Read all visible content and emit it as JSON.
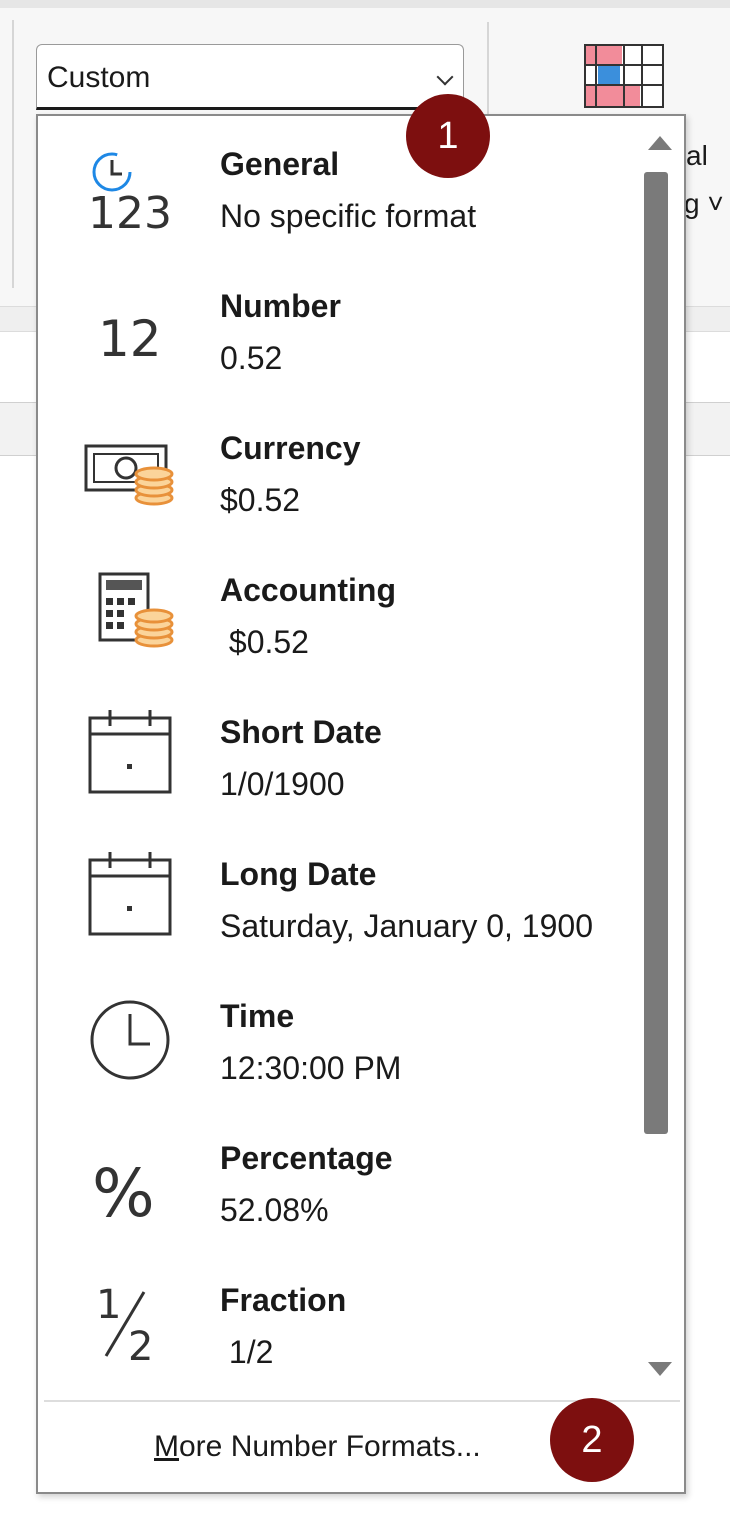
{
  "combo": {
    "value": "Custom"
  },
  "ribbon_right": {
    "label_line1": "al",
    "label_line2": "g ˅"
  },
  "formats": [
    {
      "title": "General",
      "sample": "No specific format",
      "icon": "general-123-icon"
    },
    {
      "title": "Number",
      "sample": "0.52",
      "icon": "number-12-icon"
    },
    {
      "title": "Currency",
      "sample": "$0.52",
      "icon": "currency-icon"
    },
    {
      "title": "Accounting",
      "sample": " $0.52",
      "icon": "accounting-calculator-icon"
    },
    {
      "title": "Short Date",
      "sample": "1/0/1900",
      "icon": "calendar-icon"
    },
    {
      "title": "Long Date",
      "sample": "Saturday, January 0, 1900",
      "icon": "calendar-icon"
    },
    {
      "title": "Time",
      "sample": "12:30:00 PM",
      "icon": "clock-icon"
    },
    {
      "title": "Percentage",
      "sample": "52.08%",
      "icon": "percent-icon"
    },
    {
      "title": "Fraction",
      "sample": " 1/2",
      "icon": "fraction-icon"
    }
  ],
  "footer": {
    "mnemonic": "M",
    "label_rest": "ore Number Formats..."
  },
  "badges": {
    "one": "1",
    "two": "2"
  },
  "icon_text": {
    "general": "123",
    "number": "12",
    "percent": "%",
    "fraction_num": "1",
    "fraction_den": "2"
  },
  "colors": {
    "badge": "#7d0f0f",
    "accent_orange": "#e8913a",
    "clock_blue": "#1e88e5"
  }
}
